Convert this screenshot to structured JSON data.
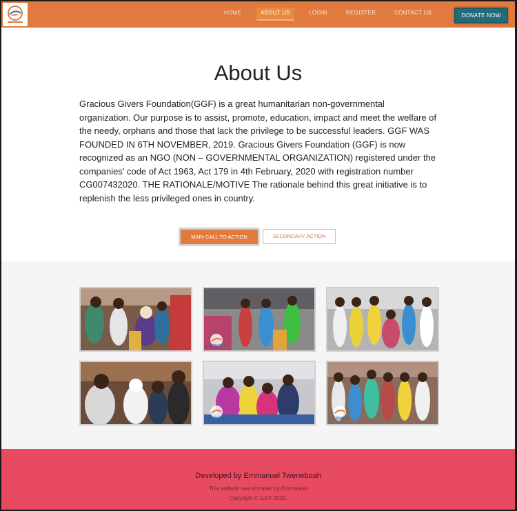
{
  "nav": {
    "logo_icon": "ggf-logo-icon",
    "links": [
      {
        "label": "HOME",
        "active": false
      },
      {
        "label": "ABOUT US",
        "active": true
      },
      {
        "label": "LOGIN",
        "active": false
      },
      {
        "label": "REGISTER",
        "active": false
      },
      {
        "label": "CONTACT US",
        "active": false
      }
    ],
    "donate_label": "DONATE NOW"
  },
  "about": {
    "title": "About Us",
    "body": "Gracious Givers Foundation(GGF) is a great humanitarian non-governmental organization. Our purpose is to assist, promote, education, impact and meet the welfare of the needy, orphans and those that lack the privilege to be successful leaders. GGF WAS FOUNDED IN 6TH NOVEMBER, 2019. Gracious Givers Foundation (GGF) is now recognized as an NGO (NON – GOVERNMENTAL ORGANIZATION) registered under the companies' code of Act 1963, Act 179 in 4th February, 2020 with registration number CG007432020. THE RATIONALE/MOTIVE The rationale behind this great initiative is to replenish the less privileged ones in country.",
    "primary_cta": "MAIN CALL TO ACTION",
    "secondary_cta": "SECONDARY ACTION"
  },
  "gallery": {
    "photos": [
      {
        "name": "gallery-photo-1",
        "watermark": ""
      },
      {
        "name": "gallery-photo-2",
        "watermark": "STREET"
      },
      {
        "name": "gallery-photo-3",
        "watermark": ""
      },
      {
        "name": "gallery-photo-4",
        "watermark": ""
      },
      {
        "name": "gallery-photo-5",
        "watermark": "STREET"
      },
      {
        "name": "gallery-photo-6",
        "watermark": "STREET"
      }
    ]
  },
  "footer": {
    "developer": "Developed by Emmanuel Tweneboah",
    "note": "This website was donated by Emmanuel",
    "copyright": "Copyright © GGF 2020."
  },
  "colors": {
    "nav_bg": "#e07a3f",
    "donate_bg": "#236b79",
    "footer_bg": "#e84a62",
    "gallery_bg": "#f5f5f5"
  }
}
